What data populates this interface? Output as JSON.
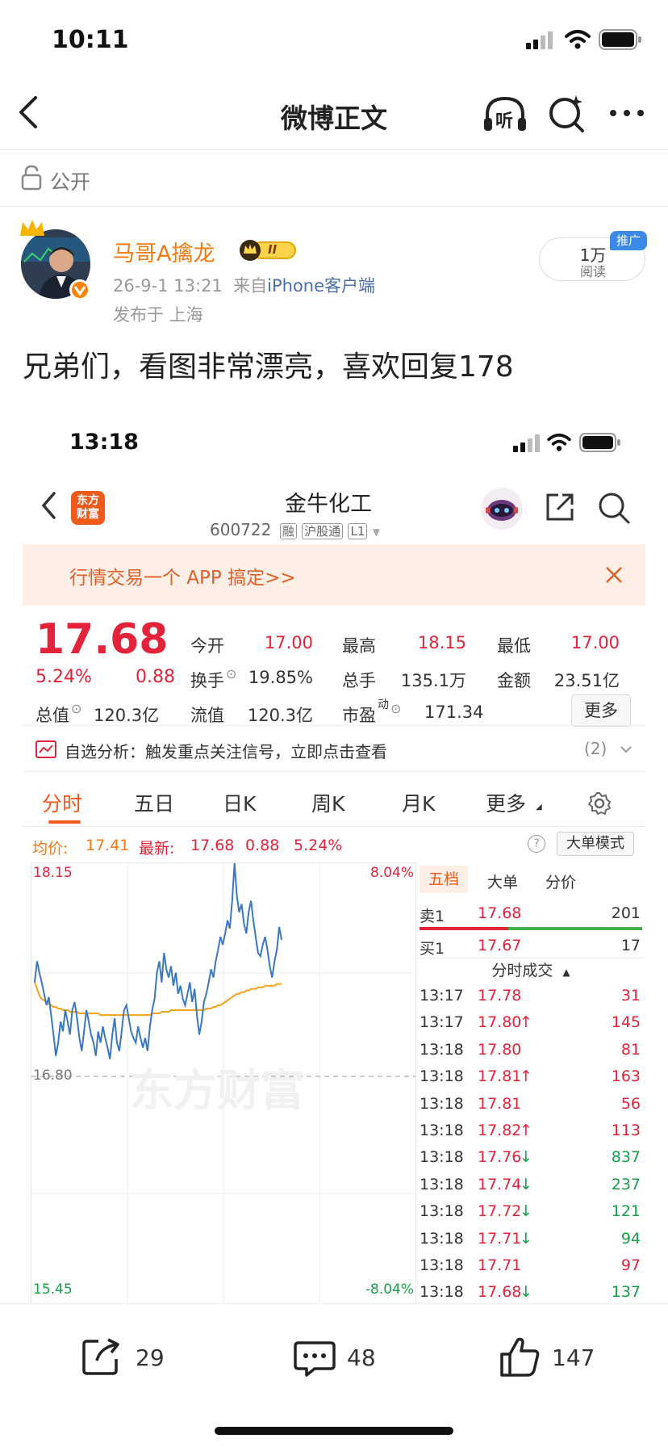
{
  "status": {
    "time": "10:11"
  },
  "nav": {
    "title": "微博正文",
    "listen": "听"
  },
  "post": {
    "visibility": "公开",
    "author": "马哥A擒龙",
    "vip_level": "II",
    "time": "26-9-1 13:21",
    "source_prefix": "来自",
    "source": "iPhone客户端",
    "location": "发布于 上海",
    "reads_count": "1万",
    "reads_label": "阅读",
    "promo_badge": "推广",
    "text": "兄弟们，看图非常漂亮，喜欢回复178"
  },
  "shot": {
    "time": "13:18",
    "logo_line1": "东方",
    "logo_line2": "财富",
    "stock_name": "金牛化工",
    "stock_code": "600722",
    "tag1": "融",
    "tag2": "沪股通",
    "tag3": "L1",
    "banner": "行情交易一个 APP 搞定>>",
    "price": "17.68",
    "change_pct": "5.24%",
    "change": "0.88",
    "open_label": "今开",
    "open": "17.00",
    "high_label": "最高",
    "high": "18.15",
    "low_label": "最低",
    "low": "17.00",
    "turnover_label": "换手",
    "turnover": "19.85%",
    "volume_label": "总手",
    "volume": "135.1万",
    "amount_label": "金额",
    "amount": "23.51亿",
    "mcap_label": "总值",
    "mcap": "120.3亿",
    "float_label": "流值",
    "float": "120.3亿",
    "pe_label": "市盈",
    "pe_sup": "动",
    "pe": "171.34",
    "more_btn": "更多",
    "analysis": "自选分析：触发重点关注信号，立即点击查看",
    "analysis_count": "(2)",
    "tabs": [
      "分时",
      "五日",
      "日K",
      "周K",
      "月K",
      "更多"
    ],
    "avg_label": "均价:",
    "avg": "17.41",
    "latest_label": "最新:",
    "latest": "17.68",
    "latest_chg": "0.88",
    "latest_pct": "5.24%",
    "mode_btn": "大单模式",
    "watermark": "东方财富",
    "side_tabs": [
      "五档",
      "大单",
      "分价"
    ],
    "sell_label": "卖1",
    "sell_price": "17.68",
    "sell_vol": "201",
    "buy_label": "买1",
    "buy_price": "17.67",
    "buy_vol": "17",
    "trades_title": "分时成交",
    "trades": [
      {
        "t": "13:17",
        "p": "17.78",
        "a": "",
        "v": "31",
        "c": "red"
      },
      {
        "t": "13:17",
        "p": "17.80",
        "a": "↑",
        "v": "145",
        "c": "red"
      },
      {
        "t": "13:18",
        "p": "17.80",
        "a": "",
        "v": "81",
        "c": "red"
      },
      {
        "t": "13:18",
        "p": "17.81",
        "a": "↑",
        "v": "163",
        "c": "red"
      },
      {
        "t": "13:18",
        "p": "17.81",
        "a": "",
        "v": "56",
        "c": "red"
      },
      {
        "t": "13:18",
        "p": "17.82",
        "a": "↑",
        "v": "113",
        "c": "red"
      },
      {
        "t": "13:18",
        "p": "17.76",
        "a": "↓",
        "v": "837",
        "c": "green"
      },
      {
        "t": "13:18",
        "p": "17.74",
        "a": "↓",
        "v": "237",
        "c": "green"
      },
      {
        "t": "13:18",
        "p": "17.72",
        "a": "↓",
        "v": "121",
        "c": "green"
      },
      {
        "t": "13:18",
        "p": "17.71",
        "a": "↓",
        "v": "94",
        "c": "green"
      },
      {
        "t": "13:18",
        "p": "17.71",
        "a": "",
        "v": "97",
        "c": "red"
      },
      {
        "t": "13:18",
        "p": "17.68",
        "a": "↓",
        "v": "137",
        "c": "green"
      }
    ]
  },
  "actions": {
    "share": "29",
    "comment": "48",
    "like": "147"
  },
  "chart_data": {
    "type": "line",
    "y_top": "18.15",
    "y_mid": "16.80",
    "y_bottom": "15.45",
    "pct_top": "8.04%",
    "pct_bottom": "-8.04%",
    "ylim": [
      15.45,
      18.15
    ],
    "series": [
      {
        "values": [
          17.42,
          17.55,
          17.48,
          17.42,
          17.35,
          17.28,
          17.33,
          17.22,
          17.1,
          16.97,
          17.05,
          17.18,
          17.12,
          17.25,
          17.18,
          17.1,
          17.25,
          17.3,
          17.2,
          17.08,
          17.0,
          17.12,
          17.25,
          17.18,
          17.1,
          17.05,
          16.97,
          17.12,
          17.05,
          17.15,
          17.08,
          17.02,
          16.95,
          17.1,
          17.2,
          17.05,
          17.0,
          17.12,
          17.25,
          17.28,
          17.2,
          17.12,
          17.08,
          17.05,
          17.15,
          17.08,
          17.02,
          17.08,
          17.0,
          17.15,
          17.25,
          17.32,
          17.48,
          17.55,
          17.42,
          17.6,
          17.5,
          17.45,
          17.52,
          17.4,
          17.48,
          17.35,
          17.4,
          17.32,
          17.28,
          17.35,
          17.42,
          17.3,
          17.38,
          17.22,
          17.1,
          17.18,
          17.3,
          17.35,
          17.42,
          17.5,
          17.45,
          17.55,
          17.62,
          17.7,
          17.65,
          17.72,
          17.8,
          17.75,
          17.92,
          18.15,
          17.95,
          17.85,
          17.9,
          17.78,
          17.72,
          17.85,
          17.92,
          17.8,
          17.7,
          17.6,
          17.58,
          17.65,
          17.7,
          17.62,
          17.52,
          17.45,
          17.55,
          17.62,
          17.76,
          17.68
        ]
      },
      {
        "values": [
          17.42,
          17.38,
          17.34,
          17.32,
          17.31,
          17.3,
          17.29,
          17.28,
          17.27,
          17.27,
          17.26,
          17.26,
          17.25,
          17.25,
          17.25,
          17.24,
          17.24,
          17.24,
          17.24,
          17.23,
          17.23,
          17.23,
          17.23,
          17.23,
          17.23,
          17.23,
          17.23,
          17.23,
          17.22,
          17.22,
          17.22,
          17.22,
          17.22,
          17.22,
          17.22,
          17.22,
          17.22,
          17.22,
          17.22,
          17.22,
          17.22,
          17.22,
          17.22,
          17.22,
          17.22,
          17.22,
          17.22,
          17.22,
          17.22,
          17.22,
          17.23,
          17.23,
          17.23,
          17.23,
          17.24,
          17.24,
          17.24,
          17.24,
          17.25,
          17.25,
          17.25,
          17.25,
          17.25,
          17.25,
          17.25,
          17.25,
          17.25,
          17.25,
          17.25,
          17.25,
          17.25,
          17.25,
          17.25,
          17.26,
          17.26,
          17.26,
          17.27,
          17.27,
          17.28,
          17.28,
          17.29,
          17.3,
          17.31,
          17.32,
          17.33,
          17.34,
          17.35,
          17.35,
          17.36,
          17.36,
          17.37,
          17.37,
          17.38,
          17.38,
          17.38,
          17.39,
          17.39,
          17.39,
          17.4,
          17.4,
          17.4,
          17.4,
          17.4,
          17.41,
          17.41,
          17.41
        ]
      }
    ]
  }
}
